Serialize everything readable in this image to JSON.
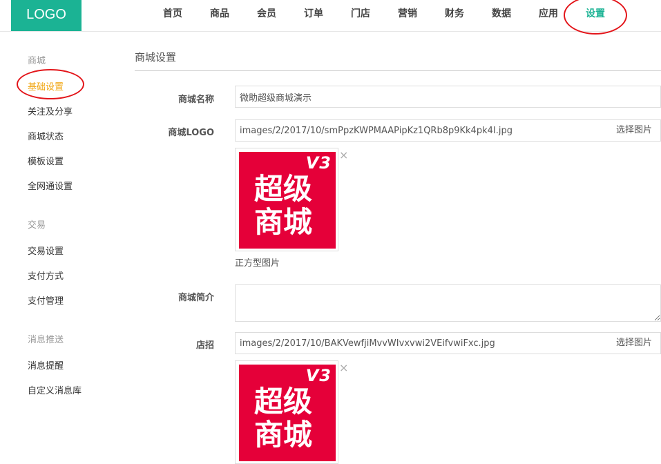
{
  "header": {
    "logo": "LOGO",
    "nav": [
      "首页",
      "商品",
      "会员",
      "订单",
      "门店",
      "营销",
      "财务",
      "数据",
      "应用",
      "设置"
    ],
    "active_nav": "设置"
  },
  "sidebar": {
    "groups": [
      {
        "title": "商城",
        "items": [
          "基础设置",
          "关注及分享",
          "商城状态",
          "模板设置",
          "全网通设置"
        ]
      },
      {
        "title": "交易",
        "items": [
          "交易设置",
          "支付方式",
          "支付管理"
        ]
      },
      {
        "title": "消息推送",
        "items": [
          "消息提醒",
          "自定义消息库"
        ]
      }
    ],
    "active_item": "基础设置"
  },
  "main": {
    "page_title": "商城设置",
    "fields": {
      "shop_name": {
        "label": "商城名称",
        "value": "微助超级商城演示"
      },
      "shop_logo": {
        "label": "商城LOGO",
        "value": "images/2/2017/10/smPpzKWPMAAPipKz1QRb8p9Kk4pk4I.jpg",
        "button": "选择图片",
        "hint": "正方型图片"
      },
      "shop_intro": {
        "label": "商城简介",
        "value": ""
      },
      "shop_sign": {
        "label": "店招",
        "value": "images/2/2017/10/BAKVewfjiMvvWIvxvwi2VEifvwiFxc.jpg",
        "button": "选择图片"
      }
    },
    "thumbnail": {
      "badge": "V3",
      "line1": "超级",
      "line2": "商城",
      "close": "×"
    }
  },
  "colors": {
    "accent": "#1bb394",
    "active_side": "#f0a30a",
    "thumb_bg": "#e50039",
    "annotation": "#e3151a"
  }
}
